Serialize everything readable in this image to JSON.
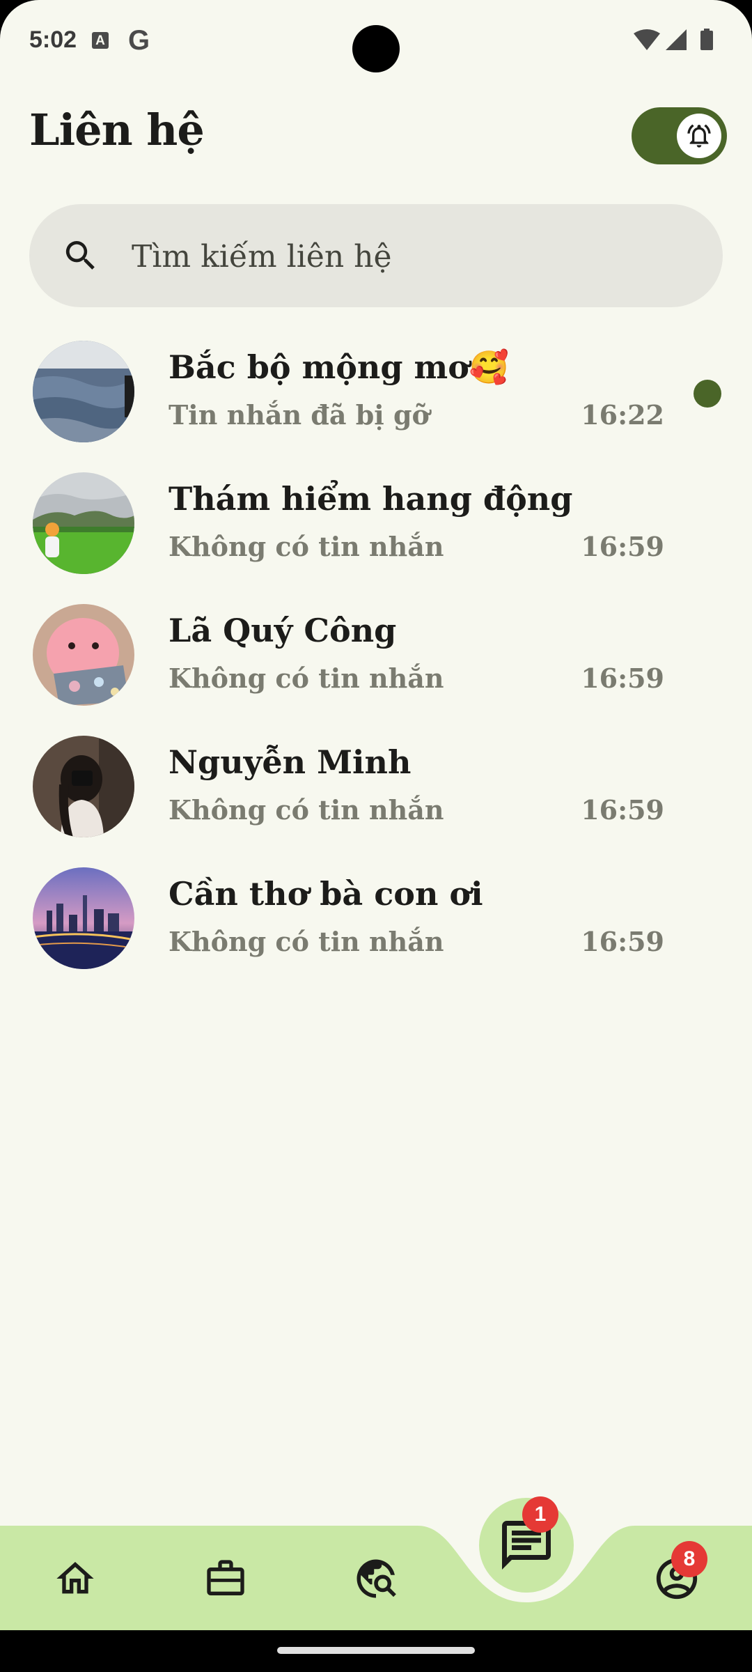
{
  "status_bar": {
    "time": "5:02",
    "icon_a": "A",
    "icon_g": "G"
  },
  "header": {
    "title": "Liên hệ"
  },
  "search": {
    "placeholder": "Tìm kiếm liên hệ"
  },
  "contacts": [
    {
      "name": "Bắc bộ mộng mơ🥰",
      "preview": "Tin nhắn đã bị gỡ",
      "time": "16:22",
      "unread": true
    },
    {
      "name": "Thám hiểm hang động",
      "preview": "Không có tin nhắn",
      "time": "16:59",
      "unread": false
    },
    {
      "name": "Lã Quý Công",
      "preview": "Không có tin nhắn",
      "time": "16:59",
      "unread": false
    },
    {
      "name": "Nguyễn Minh",
      "preview": "Không có tin nhắn",
      "time": "16:59",
      "unread": false
    },
    {
      "name": "Cần thơ bà con ơi",
      "preview": "Không có tin nhắn",
      "time": "16:59",
      "unread": false
    }
  ],
  "bottom_nav": {
    "items": [
      "home-icon",
      "briefcase-icon",
      "travel-explore-icon",
      "chat-icon",
      "account-icon"
    ],
    "chat_badge": "1",
    "account_badge": "8"
  },
  "colors": {
    "accent": "#4a6528",
    "nav_bg": "#c9e8a5",
    "background": "#f7f8ef",
    "badge": "#e53935"
  }
}
